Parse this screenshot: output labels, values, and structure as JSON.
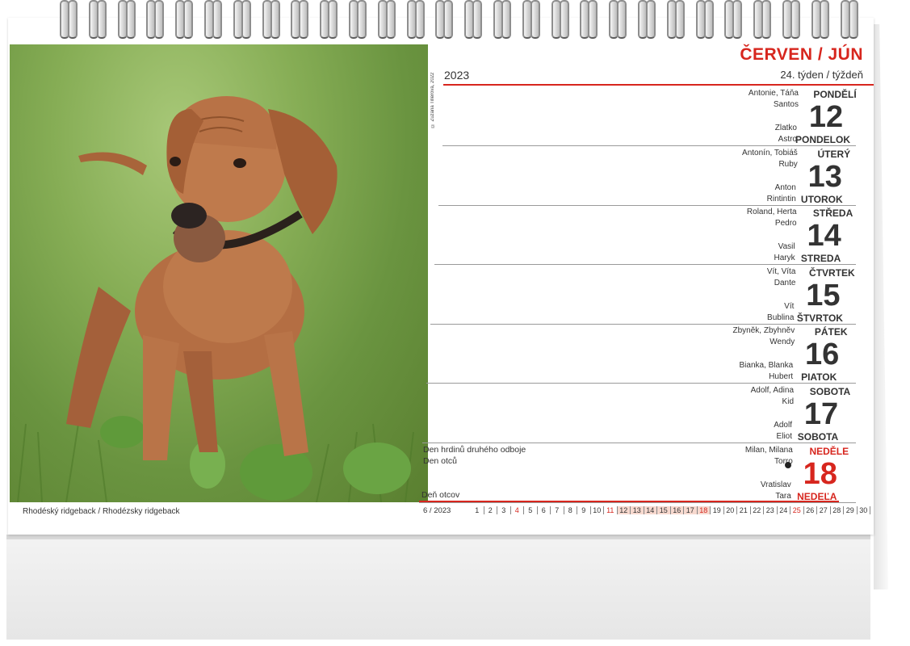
{
  "photo": {
    "credit": "© Zuzana Tillerová, 2022",
    "caption": "Rhodéský ridgeback / Rhodézsky ridgeback"
  },
  "header": {
    "month": "ČERVEN / JÚN",
    "year": "2023",
    "week": "24. týden / týždeň"
  },
  "days": [
    {
      "name_cz": "PONDĚLÍ",
      "number": "12",
      "name_sk": "PONDELOK",
      "names_top": [
        "Antonie, Táňa",
        "Santos"
      ],
      "names_bottom": [
        "Zlatko",
        "Astro"
      ]
    },
    {
      "name_cz": "ÚTERÝ",
      "number": "13",
      "name_sk": "UTOROK",
      "names_top": [
        "Antonín, Tobiáš",
        "Ruby"
      ],
      "names_bottom": [
        "Anton",
        "Rintintin"
      ]
    },
    {
      "name_cz": "STŘEDA",
      "number": "14",
      "name_sk": "STREDA",
      "names_top": [
        "Roland, Herta",
        "Pedro"
      ],
      "names_bottom": [
        "Vasil",
        "Haryk"
      ]
    },
    {
      "name_cz": "ČTVRTEK",
      "number": "15",
      "name_sk": "ŠTVRTOK",
      "names_top": [
        "Vít, Víta",
        "Dante"
      ],
      "names_bottom": [
        "Vít",
        "Bublina"
      ]
    },
    {
      "name_cz": "PÁTEK",
      "number": "16",
      "name_sk": "PIATOK",
      "names_top": [
        "Zbyněk, Zbyhněv",
        "Wendy"
      ],
      "names_bottom": [
        "Bianka, Blanka",
        "Hubert"
      ]
    },
    {
      "name_cz": "SOBOTA",
      "number": "17",
      "name_sk": "SOBOTA",
      "names_top": [
        "Adolf, Adina",
        "Kid"
      ],
      "names_bottom": [
        "Adolf",
        "Eliot"
      ]
    },
    {
      "name_cz": "NEDĚLE",
      "number": "18",
      "name_sk": "NEDEĽA",
      "names_top": [
        "Milan, Milana",
        "Torro"
      ],
      "names_bottom": [
        "Vratislav",
        "Tara"
      ]
    }
  ],
  "holidays": {
    "cz_1": "Den hrdinů druhého odboje",
    "cz_2": "Den otců",
    "sk_1": "Deň otcov"
  },
  "mini_calendar": {
    "label": "6 / 2023",
    "days": [
      "1",
      "2",
      "3",
      "4",
      "5",
      "6",
      "7",
      "8",
      "9",
      "10",
      "11",
      "12",
      "13",
      "14",
      "15",
      "16",
      "17",
      "18",
      "19",
      "20",
      "21",
      "22",
      "23",
      "24",
      "25",
      "26",
      "27",
      "28",
      "29",
      "30"
    ],
    "red_days": [
      "4",
      "11",
      "18",
      "25"
    ],
    "highlighted_days": [
      "12",
      "13",
      "14",
      "15",
      "16",
      "17",
      "18"
    ]
  },
  "colors": {
    "accent": "#d7261e",
    "text": "#333333"
  }
}
